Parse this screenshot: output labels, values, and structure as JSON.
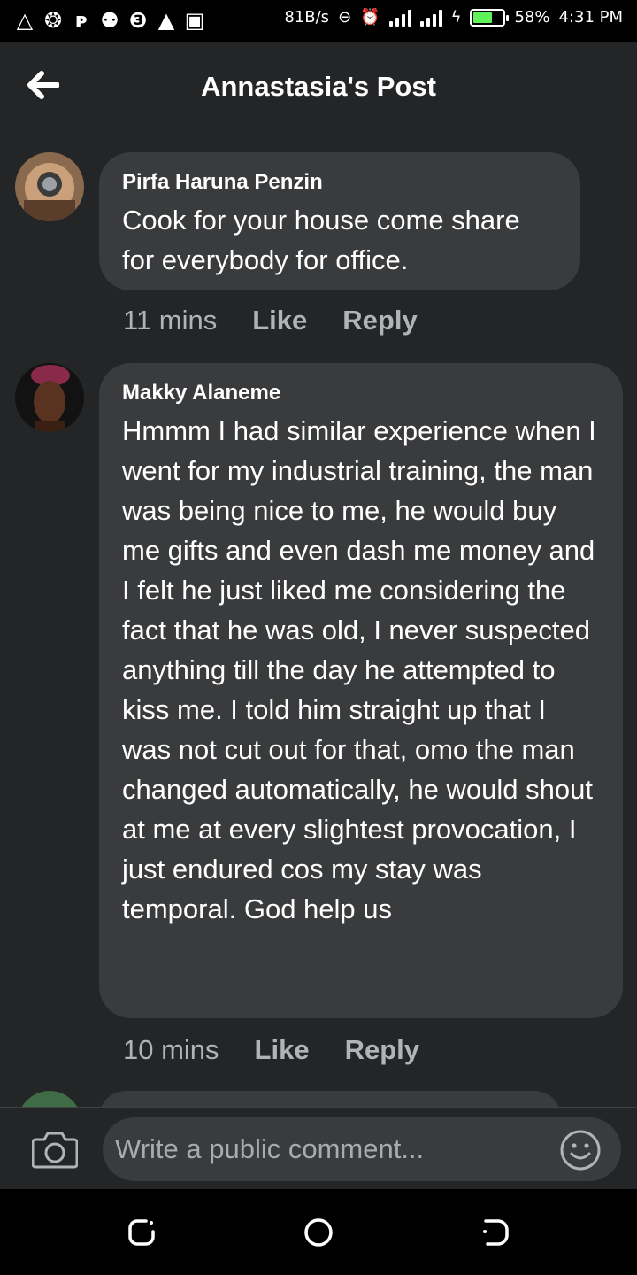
{
  "status_bar": {
    "notification_icons": [
      "warning-outline-icon",
      "app-icon",
      "p-icon",
      "p-icon",
      "b-icon",
      "warning-icon",
      "image-icon"
    ],
    "net_speed": "81B/s",
    "battery_pct": "58%",
    "time": "4:31 PM"
  },
  "header": {
    "title": "Annastasia's Post"
  },
  "comments": [
    {
      "author": "Pirfa Haruna Penzin",
      "text": "Cook for your house come share for everybody for office.",
      "time": "11 mins",
      "like": "Like",
      "reply": "Reply"
    },
    {
      "author": "Makky Alaneme",
      "text": "Hmmm I had similar experience when I went for my industrial training, the man was being nice to me, he would buy me gifts and even dash me money and I felt he just liked me considering the fact that he was old, I never suspected anything till the day he attempted to kiss me. I told him straight up that I was not cut out for that, omo the man changed automatically, he would shout at me at every slightest provocation, I just endured cos my stay was temporal. God help us",
      "time": "10 mins",
      "like": "Like",
      "reply": "Reply"
    }
  ],
  "composer": {
    "placeholder": "Write a public comment..."
  },
  "colors": {
    "background": "#242526",
    "bubble": "#3a3b3c",
    "meta_text": "#b0b3b8"
  }
}
